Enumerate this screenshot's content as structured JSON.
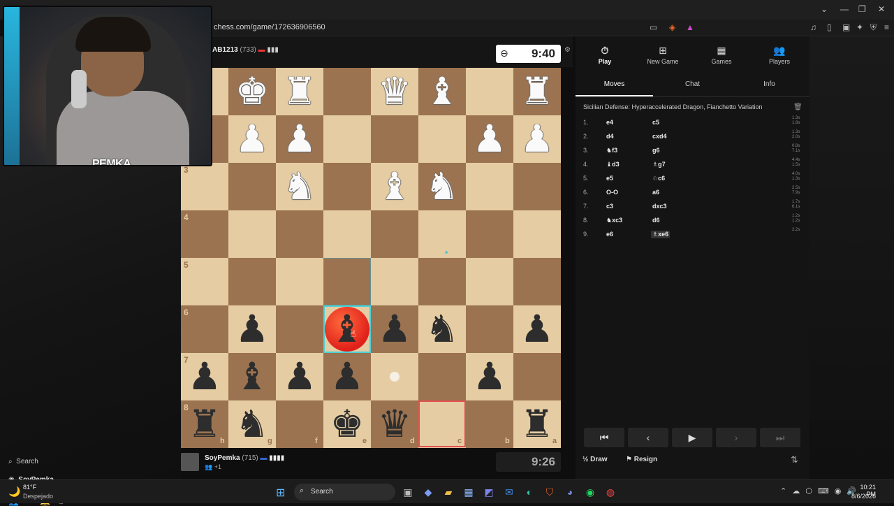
{
  "browser": {
    "url": "chess.com/game/172636906560",
    "window_controls": [
      "⌄",
      "—",
      "❐",
      "✕"
    ]
  },
  "webcam": {
    "tag": "PEMKA"
  },
  "left": {
    "search_label": "Search",
    "username": "SoyPemka"
  },
  "board": {
    "ranks": [
      "3",
      "4",
      "5",
      "6",
      "7",
      "8"
    ],
    "files": [
      "h",
      "g",
      "f",
      "e",
      "d",
      "c",
      "b",
      "a"
    ],
    "pieces": [
      {
        "r": 0,
        "c": 1,
        "g": "♚",
        "color": "w"
      },
      {
        "r": 0,
        "c": 2,
        "g": "♜",
        "color": "w"
      },
      {
        "r": 0,
        "c": 4,
        "g": "♛",
        "color": "w"
      },
      {
        "r": 0,
        "c": 5,
        "g": "♝",
        "color": "w"
      },
      {
        "r": 0,
        "c": 7,
        "g": "♜",
        "color": "w"
      },
      {
        "r": 1,
        "c": 1,
        "g": "♟",
        "color": "w"
      },
      {
        "r": 1,
        "c": 2,
        "g": "♟",
        "color": "w"
      },
      {
        "r": 1,
        "c": 6,
        "g": "♟",
        "color": "w"
      },
      {
        "r": 1,
        "c": 7,
        "g": "♟",
        "color": "w"
      },
      {
        "r": 2,
        "c": 2,
        "g": "♞",
        "color": "w"
      },
      {
        "r": 2,
        "c": 4,
        "g": "♝",
        "color": "w"
      },
      {
        "r": 2,
        "c": 5,
        "g": "♞",
        "color": "w"
      },
      {
        "r": 5,
        "c": 1,
        "g": "♟",
        "color": "b"
      },
      {
        "r": 5,
        "c": 3,
        "g": "♝",
        "color": "b"
      },
      {
        "r": 5,
        "c": 4,
        "g": "♟",
        "color": "b"
      },
      {
        "r": 5,
        "c": 5,
        "g": "♞",
        "color": "b"
      },
      {
        "r": 5,
        "c": 7,
        "g": "♟",
        "color": "b"
      },
      {
        "r": 6,
        "c": 0,
        "g": "♟",
        "color": "b"
      },
      {
        "r": 6,
        "c": 1,
        "g": "♝",
        "color": "b"
      },
      {
        "r": 6,
        "c": 2,
        "g": "♟",
        "color": "b"
      },
      {
        "r": 6,
        "c": 3,
        "g": "♟",
        "color": "b"
      },
      {
        "r": 6,
        "c": 6,
        "g": "♟",
        "color": "b"
      },
      {
        "r": 7,
        "c": 0,
        "g": "♜",
        "color": "b"
      },
      {
        "r": 7,
        "c": 1,
        "g": "♞",
        "color": "b"
      },
      {
        "r": 7,
        "c": 3,
        "g": "♚",
        "color": "b"
      },
      {
        "r": 7,
        "c": 4,
        "g": "♛",
        "color": "b"
      },
      {
        "r": 7,
        "c": 7,
        "g": "♜",
        "color": "b"
      }
    ]
  },
  "top_player": {
    "name": "AB1213",
    "rating": "(733)",
    "clock": "9:40"
  },
  "bottom_player": {
    "name": "SoyPemka",
    "rating": "(715)",
    "sub": "+1",
    "clock": "9:26"
  },
  "panel": {
    "nav": [
      {
        "label": "Play",
        "icon": "⏱"
      },
      {
        "label": "New Game",
        "icon": "⊞"
      },
      {
        "label": "Games",
        "icon": "▦"
      },
      {
        "label": "Players",
        "icon": "👥"
      }
    ],
    "tabs": [
      "Moves",
      "Chat",
      "Info"
    ],
    "opening": "Sicilian Defense: Hyperaccelerated Dragon, Fianchetto Variation",
    "moves": [
      {
        "n": "1.",
        "w": "e4",
        "b": "c5",
        "tw": "1.3s",
        "tb": "1.8s"
      },
      {
        "n": "2.",
        "w": "d4",
        "b": "cxd4",
        "tw": "1.3s",
        "tb": "2.0s"
      },
      {
        "n": "3.",
        "w": "♞f3",
        "b": "g6",
        "tw": "0.8s",
        "tb": "7.1s"
      },
      {
        "n": "4.",
        "w": "♝d3",
        "b": "♗g7",
        "tw": "4.4s",
        "tb": "1.5s"
      },
      {
        "n": "5.",
        "w": "e5",
        "b": "♘c6",
        "tw": "4.0s",
        "tb": "1.3s"
      },
      {
        "n": "6.",
        "w": "O-O",
        "b": "a6",
        "tw": "2.5s",
        "tb": "7.9s"
      },
      {
        "n": "7.",
        "w": "c3",
        "b": "dxc3",
        "tw": "1.7s",
        "tb": "6.1s"
      },
      {
        "n": "8.",
        "w": "♞xc3",
        "b": "d6",
        "tw": "1.2s",
        "tb": "1.2s"
      },
      {
        "n": "9.",
        "w": "e6",
        "b": "♗xe6",
        "tw": "2.2s",
        "tb": ""
      }
    ],
    "nav_buttons": [
      "⏮",
      "‹",
      "▶",
      "›",
      "⏭"
    ],
    "draw": "½ Draw",
    "resign": "⚑ Resign"
  },
  "taskbar": {
    "weather_temp": "81°F",
    "weather_desc": "Despejado",
    "search": "Search",
    "time": "10:21 PM",
    "date": "8/6/2026"
  }
}
